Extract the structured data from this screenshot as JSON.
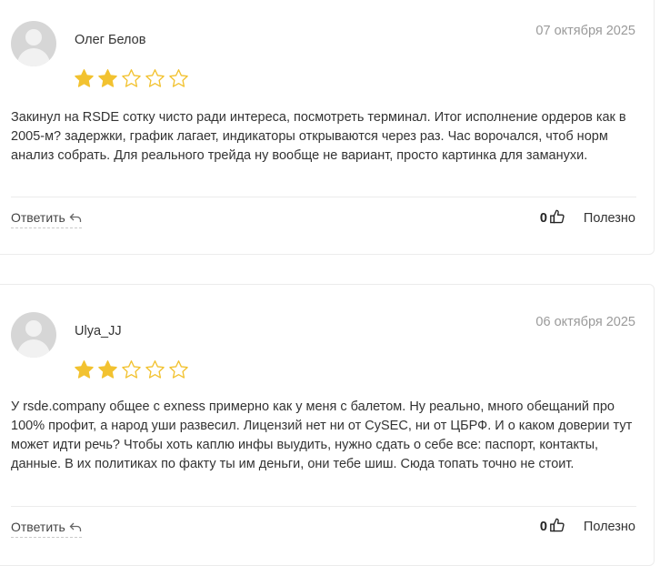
{
  "reviews": [
    {
      "author": "Олег Белов",
      "date": "07 октября 2025",
      "rating": 2,
      "max_rating": 5,
      "text": "Закинул на RSDE сотку чисто ради интереса, посмотреть терминал. Итог исполнение ордеров как в 2005-м? задержки, график лагает, индикаторы открываются через раз. Час ворочался, чтоб норм анализ собрать. Для реального трейда ну вообще не вариант, просто картинка для заманухи.",
      "reply_label": "Ответить",
      "likes": "0",
      "useful_label": "Полезно"
    },
    {
      "author": "Ulya_JJ",
      "date": "06 октября 2025",
      "rating": 2,
      "max_rating": 5,
      "text": "У rsde.company общее с exness примерно как у меня с балетом. Ну реально, много обещаний про 100% профит, а народ уши развесил. Лицензий нет ни от CySEC, ни от ЦБРФ. И о каком доверии тут может идти речь? Чтобы хоть каплю инфы выудить, нужно сдать о себе все: паспорт, контакты, данные. В их политиках по факту ты им деньги, они тебе шиш. Сюда топать точно не стоит.",
      "reply_label": "Ответить",
      "likes": "0",
      "useful_label": "Полезно"
    }
  ],
  "colors": {
    "star_filled": "#F2C230",
    "star_empty_stroke": "#F2C230",
    "avatar_bg": "#D6D6D6",
    "date_text": "#9A9A9A",
    "divider": "#ECECEC"
  },
  "icons": {
    "star": "star-icon",
    "reply": "reply-arrow-icon",
    "like": "thumbs-up-icon",
    "avatar": "default-user-avatar"
  }
}
